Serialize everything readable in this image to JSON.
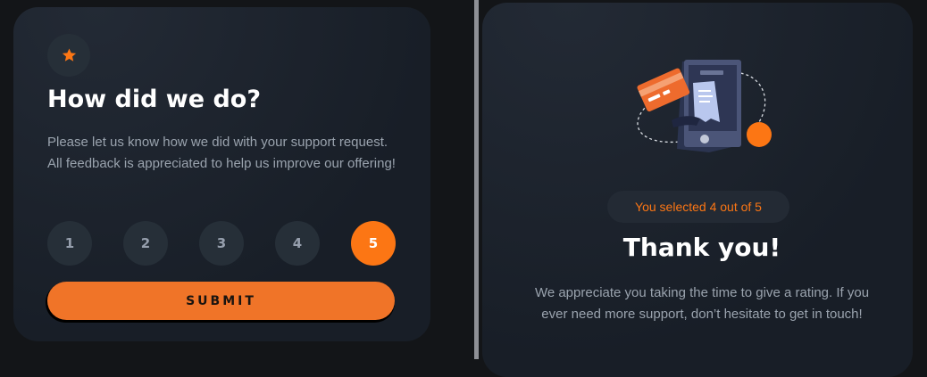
{
  "rating_card": {
    "title": "How did we do?",
    "description": "Please let us know how we did with your support request. All feedback is appreciated to help us improve our offering!",
    "ratings": [
      "1",
      "2",
      "3",
      "4",
      "5"
    ],
    "selected_rating": 5,
    "submit_label": "SUBMIT",
    "icon": "star-icon"
  },
  "thank_you_card": {
    "selection_text": "You selected 4 out of 5",
    "title": "Thank you!",
    "description": "We appreciate you taking the time to give a rating. If you ever need more support, don’t hesitate to get in touch!",
    "illustration": "phone-receipt-illustration"
  },
  "colors": {
    "accent": "#fc7614",
    "submit": "#f07428",
    "card_bg": "#181e27",
    "button_bg": "#262f38",
    "text_muted": "#9aa3ae",
    "page_bg": "#131518",
    "divider": "#8e9096"
  }
}
